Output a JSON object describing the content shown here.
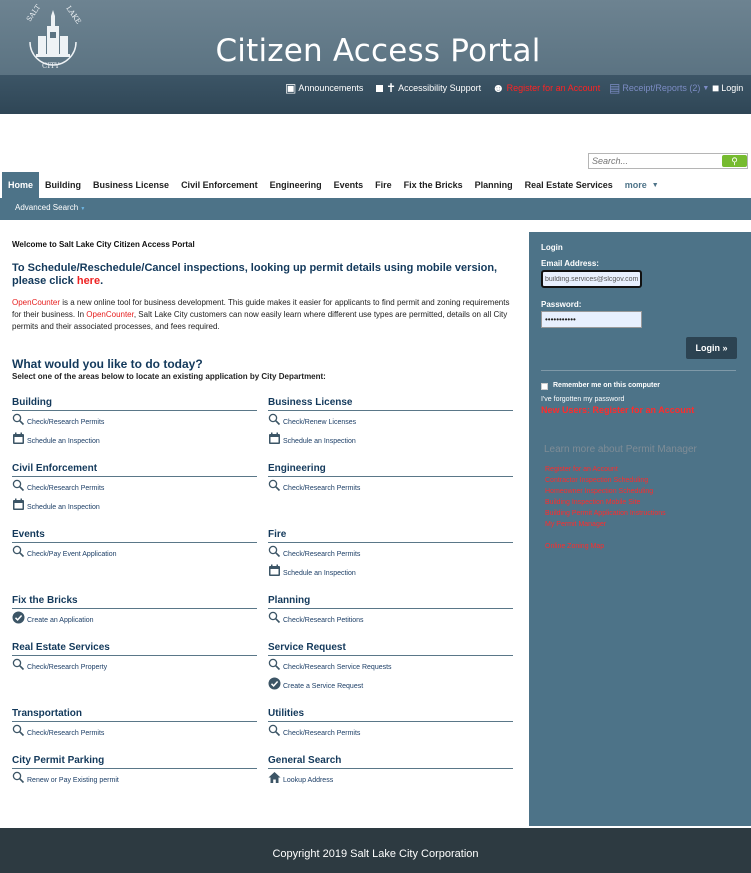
{
  "header": {
    "title": "Citizen Access Portal",
    "logo_text": "SALT LAKE CITY",
    "links": {
      "announcements": "Announcements",
      "accessibility": "Accessibility Support",
      "register": "Register for an Account",
      "receipts": "Receipt/Reports (2)",
      "login": "Login"
    }
  },
  "search": {
    "placeholder": "Search..."
  },
  "nav": {
    "tabs": [
      "Home",
      "Building",
      "Business License",
      "Civil Enforcement",
      "Engineering",
      "Events",
      "Fire",
      "Fix the Bricks",
      "Planning",
      "Real Estate Services"
    ],
    "more": "more",
    "advanced_search": "Advanced Search"
  },
  "main": {
    "welcome": "Welcome to Salt Lake City Citizen Access Portal",
    "schedule_text": "To Schedule/Reschedule/Cancel inspections, looking up permit details using mobile version, please click",
    "schedule_link": "here",
    "intro": {
      "oc1": "OpenCounter",
      "t1": " is a new online tool for business development. This guide makes it easier for applicants to find permit and zoning requirements for their business. In ",
      "oc2": "OpenCounter",
      "t2": ", Salt Lake City customers can now easily learn where different use types are permitted, details on all City permits and their associated processes, and fees required."
    },
    "question": "What would you like to do today?",
    "instruction": "Select one of the areas below to locate an existing application by City Department:",
    "sections": [
      {
        "title": "Building",
        "links": [
          {
            "icon": "search-icon",
            "label": "Check/Research Permits"
          },
          {
            "icon": "calendar-icon",
            "label": "Schedule an Inspection"
          }
        ]
      },
      {
        "title": "Business License",
        "links": [
          {
            "icon": "search-icon",
            "label": "Check/Renew Licenses"
          },
          {
            "icon": "calendar-icon",
            "label": "Schedule an Inspection"
          }
        ]
      },
      {
        "title": "Civil Enforcement",
        "links": [
          {
            "icon": "search-icon",
            "label": "Check/Research Permits"
          },
          {
            "icon": "calendar-icon",
            "label": "Schedule an Inspection"
          }
        ]
      },
      {
        "title": "Engineering",
        "links": [
          {
            "icon": "search-icon",
            "label": "Check/Research Permits"
          }
        ]
      },
      {
        "title": "Events",
        "links": [
          {
            "icon": "search-icon",
            "label": "Check/Pay Event Application"
          }
        ]
      },
      {
        "title": "Fire",
        "links": [
          {
            "icon": "search-icon",
            "label": "Check/Research Permits"
          },
          {
            "icon": "calendar-icon",
            "label": "Schedule an Inspection"
          }
        ]
      },
      {
        "title": "Fix the Bricks",
        "links": [
          {
            "icon": "check-circle-icon",
            "label": "Create an Application"
          }
        ]
      },
      {
        "title": "Planning",
        "links": [
          {
            "icon": "search-icon",
            "label": "Check/Research Petitions"
          }
        ]
      },
      {
        "title": "Real Estate Services",
        "links": [
          {
            "icon": "search-icon",
            "label": "Check/Research Property"
          }
        ]
      },
      {
        "title": "Service Request",
        "links": [
          {
            "icon": "search-icon",
            "label": "Check/Research Service Requests"
          },
          {
            "icon": "check-circle-icon",
            "label": "Create a Service Request"
          }
        ]
      },
      {
        "title": "Transportation",
        "links": [
          {
            "icon": "search-icon",
            "label": "Check/Research Permits"
          }
        ]
      },
      {
        "title": "Utilities",
        "links": [
          {
            "icon": "search-icon",
            "label": "Check/Research Permits"
          }
        ]
      },
      {
        "title": "City Permit Parking",
        "links": [
          {
            "icon": "search-icon",
            "label": "Renew or Pay Existing permit"
          }
        ]
      },
      {
        "title": "General Search",
        "links": [
          {
            "icon": "home-icon",
            "label": "Lookup Address"
          }
        ]
      }
    ]
  },
  "login": {
    "title": "Login",
    "email_label": "Email Address:",
    "email_value": "building.services@slcgov.com",
    "password_label": "Password:",
    "password_value": "•••••••••••",
    "button": "Login »",
    "remember": "Remember me on this computer",
    "forgot": "I've forgotten my password",
    "new_users": "New Users: Register for an Account",
    "learn_more": "Learn more about Permit Manager",
    "resources": [
      "Register for an Account",
      "Contractor Inspection Scheduling",
      "Homeowner Inspection Scheduling",
      "Building Inspection Mobile Site",
      "Building Permit Application Instructions",
      "My Permit Manager",
      "Online Zoning Map"
    ]
  },
  "footer": {
    "copyright": "Copyright 2019 Salt Lake City Corporation"
  },
  "colors": {
    "header": "#5b7382",
    "accent": "#4d7388",
    "link_red": "#e62020",
    "heading": "#13395b",
    "footer": "#2d3a41",
    "search_button": "#76bb2f"
  }
}
